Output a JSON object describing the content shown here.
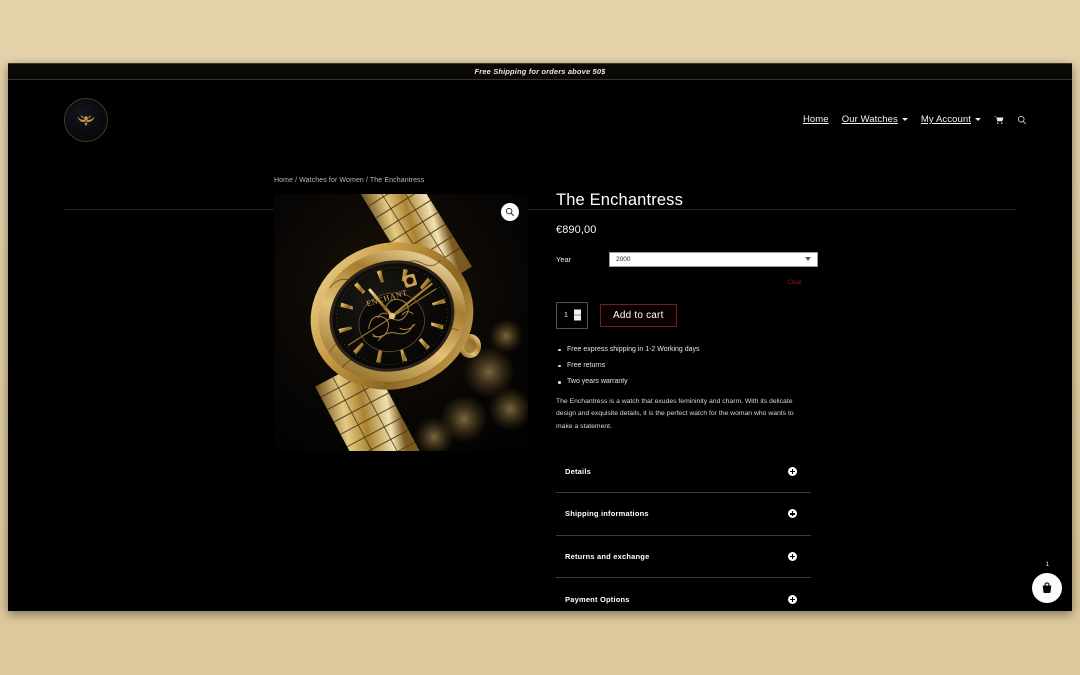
{
  "announcement": {
    "text": "Free Shipping for orders above 50$"
  },
  "header": {
    "logo_name": "eagle-emblem-logo",
    "nav": [
      {
        "label": "Home",
        "has_dropdown": false
      },
      {
        "label": "Our Watches",
        "has_dropdown": true
      },
      {
        "label": "My Account",
        "has_dropdown": true
      }
    ],
    "cart_icon": "shopping-cart-icon",
    "search_icon": "search-icon"
  },
  "breadcrumb": {
    "text": "Home / Watches for Women / The Enchantress"
  },
  "gallery": {
    "image_alt": "gold watch with ornate black dial",
    "zoom_icon": "magnifier-zoom-icon"
  },
  "product": {
    "title": "The Enchantress",
    "price": "€890,00",
    "description": "The Enchantress is a watch that exudes femininity and charm. With its delicate design and exquisite details, it is the perfect watch for the woman who wants to make a statement.",
    "perks": [
      "Free express shipping in 1-2 Working days",
      "Free returns",
      "Two years warranty"
    ]
  },
  "variations": {
    "year": {
      "label": "Year",
      "selected": "2000",
      "options": [
        "2000"
      ]
    },
    "clear_label": "Clear"
  },
  "cart": {
    "quantity": "1",
    "add_to_cart_label": "Add to cart"
  },
  "accordion": [
    {
      "label": "Details",
      "icon": "plus-circle-icon"
    },
    {
      "label": "Shipping informations",
      "icon": "plus-circle-icon"
    },
    {
      "label": "Returns and exchange",
      "icon": "plus-circle-icon"
    },
    {
      "label": "Payment Options",
      "icon": "plus-circle-icon"
    }
  ],
  "floating_cart": {
    "icon": "shopping-basket-icon",
    "count": "1"
  },
  "colors": {
    "page_background": "#000000",
    "outer_background": "#e2cfa5",
    "accent_red": "#6e2020",
    "clear_link": "#8b1a1a",
    "text_primary": "#ffffff"
  }
}
